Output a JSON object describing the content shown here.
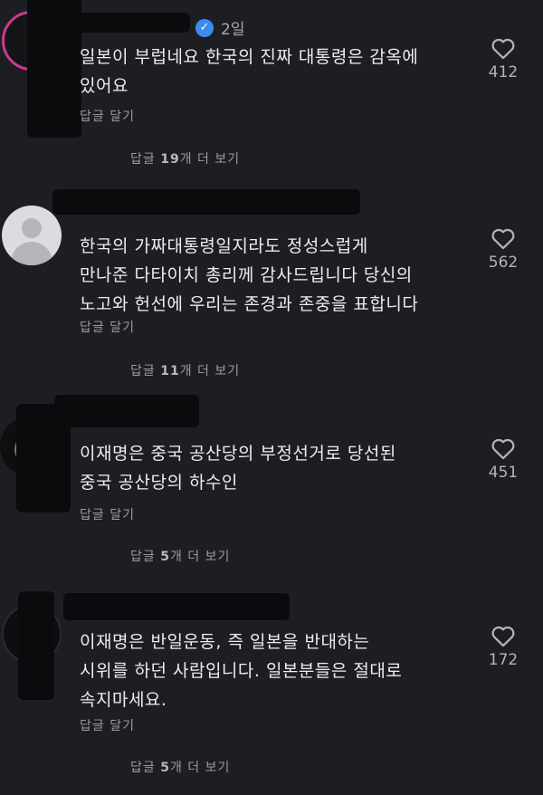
{
  "comments": [
    {
      "time": "2일",
      "text": "일본이 부럽네요 한국의 진짜 대통령은 감옥에\n있어요",
      "likes": "412",
      "reply_label": "답글 달기",
      "more_prefix": "답글 ",
      "more_count": "19",
      "more_suffix": "개 더 보기"
    },
    {
      "text": "한국의 가짜대통령일지라도 정성스럽게\n만나준 다타이치 총리께 감사드립니다 당신의\n노고와 헌선에 우리는 존경과 존중을 표합니다",
      "likes": "562",
      "reply_label": "답글 달기",
      "more_prefix": "답글 ",
      "more_count": "11",
      "more_suffix": "개 더 보기"
    },
    {
      "text": "이재명은 중국 공산당의 부정선거로 당선된\n중국 공산당의 하수인",
      "likes": "451",
      "reply_label": "답글 달기",
      "more_prefix": "답글 ",
      "more_count": "5",
      "more_suffix": "개 더 보기"
    },
    {
      "text": "이재명은 반일운동, 즉 일본을 반대하는\n시위를 하던 사람입니다. 일본분들은 절대로\n속지마세요.",
      "likes": "172",
      "reply_label": "답글 달기",
      "more_prefix": "답글 ",
      "more_count": "5",
      "more_suffix": "개 더 보기"
    }
  ],
  "icons": {
    "verified": "verified-badge-icon",
    "like": "heart-outline-icon"
  }
}
